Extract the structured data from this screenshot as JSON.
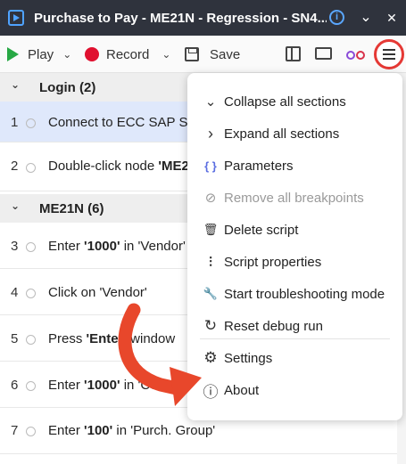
{
  "window": {
    "title": "Purchase to Pay - ME21N - Regression - SN4...",
    "minimize_glyph": "⌄",
    "close_glyph": "✕"
  },
  "toolbar": {
    "play_label": "Play",
    "record_label": "Record",
    "save_label": "Save",
    "dropdown_glyph": "⌄"
  },
  "sections": [
    {
      "label": "Login  (2)"
    },
    {
      "label": "ME21N (6)"
    }
  ],
  "steps": [
    {
      "num": "1",
      "parts": [
        "Connect to ECC SAP Sy",
        "",
        ""
      ]
    },
    {
      "num": "2",
      "parts": [
        "Double-click node ",
        "'ME2",
        ""
      ]
    },
    {
      "num": "3",
      "parts": [
        "Enter ",
        "'1000'",
        " in 'Vendor'"
      ]
    },
    {
      "num": "4",
      "parts": [
        "Click on 'Vendor'",
        "",
        ""
      ]
    },
    {
      "num": "5",
      "parts": [
        "Press ",
        "'Enter'",
        " window"
      ]
    },
    {
      "num": "6",
      "parts": [
        "Enter ",
        "'1000'",
        " in 'Compar"
      ]
    },
    {
      "num": "7",
      "parts": [
        "Enter ",
        "'100'",
        " in 'Purch. Group'"
      ]
    }
  ],
  "menu": {
    "items": [
      {
        "label": "Collapse all sections",
        "icon": "⌄"
      },
      {
        "label": "Expand all sections",
        "icon": "›"
      },
      {
        "label": "Parameters",
        "icon": "{ }"
      },
      {
        "label": "Remove all breakpoints",
        "icon": "⊘"
      },
      {
        "label": "Delete script",
        "icon": "🗑"
      },
      {
        "label": "Script properties",
        "icon": "⫶"
      },
      {
        "label": "Start troubleshooting mode",
        "icon": "🔧"
      },
      {
        "label": "Reset debug run",
        "icon": "↻"
      },
      {
        "label": "Settings",
        "icon": "⚙"
      },
      {
        "label": "About",
        "icon": "ⓘ"
      }
    ]
  },
  "colors": {
    "titlebar": "#2f333d",
    "play": "#27a844",
    "record": "#e0102f",
    "arrow": "#e8472b",
    "highlight_ring": "#e53935"
  }
}
